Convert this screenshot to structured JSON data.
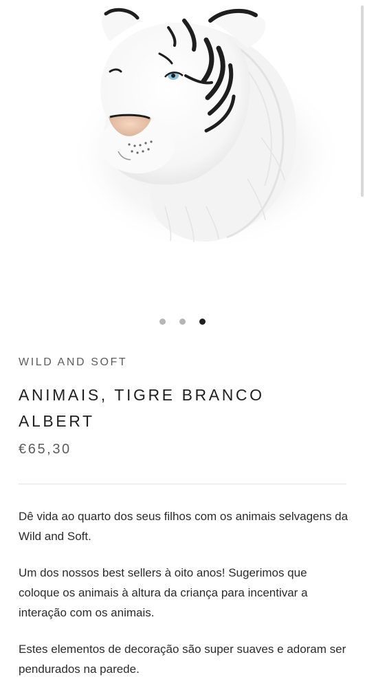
{
  "gallery": {
    "image_alt": "White tiger head plush wall decoration",
    "slide_count": 3,
    "active_slide": 3
  },
  "product": {
    "vendor": "WILD AND SOFT",
    "title": "ANIMAIS, TIGRE BRANCO ALBERT",
    "price": "€65,30"
  },
  "description": {
    "paragraphs": [
      "Dê vida ao quarto dos seus filhos com os animais selvagens da Wild and Soft.",
      "Um dos nossos best sellers à oito anos! Sugerimos que coloque os animais à altura da criança para incentivar a interação com os animais.",
      "Estes elementos de decoração são super suaves e adoram ser pendurados na parede."
    ]
  },
  "colors": {
    "text": "#1f1f1f",
    "muted": "#5c5c5c",
    "dot_inactive": "#b5b5b5",
    "dot_active": "#1f1f1f",
    "divider": "#e3e3e3"
  }
}
